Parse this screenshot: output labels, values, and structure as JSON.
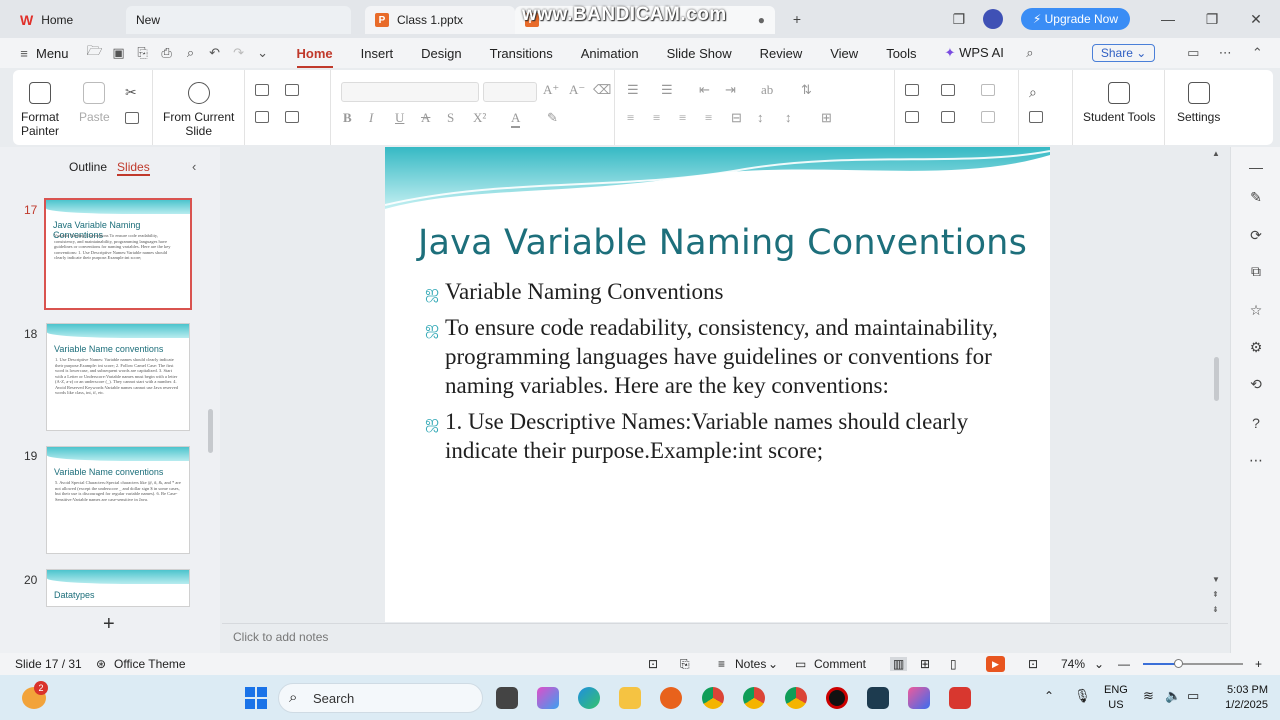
{
  "tabs": {
    "home": "Home",
    "new": "New",
    "document": "Class 1.pptx"
  },
  "watermark": "www.BANDICAM.com",
  "titlebar": {
    "upgrade": "Upgrade Now"
  },
  "menu": {
    "menu": "Menu",
    "items": [
      "Home",
      "Insert",
      "Design",
      "Transitions",
      "Animation",
      "Slide Show",
      "Review",
      "View",
      "Tools"
    ],
    "wps_ai": "WPS AI",
    "share": "Share"
  },
  "ribbon": {
    "format_painter_1": "Format",
    "format_painter_2": "Painter",
    "paste": "Paste",
    "from_current_1": "From Current",
    "from_current_2": "Slide",
    "student_tools": "Student Tools",
    "settings": "Settings"
  },
  "left_panel": {
    "outline": "Outline",
    "slides": "Slides",
    "thumbnails": [
      {
        "num": "17",
        "title": "Java Variable Naming Conventions",
        "text": "Variable Naming Conventions\nTo ensure code readability, consistency, and maintainability, programming languages have guidelines or conventions for naming variables. Here are the key conventions:\n1. Use Descriptive Names:Variable names should clearly indicate their purpose.Example:int score;"
      },
      {
        "num": "18",
        "title": "Variable Name conventions",
        "text": "1. Use Descriptive Names: Variable names should clearly indicate their purpose.Example: int score;\n2. Follow Camel Case: The first word is lowercase, and subsequent words are capitalized.\n3. Start with a Letter or Underscore:Variable names must begin with a letter (A-Z, a-z) or an underscore (_). They cannot start with a number.\n4. Avoid Reserved Keywords:Variable names cannot use Java reserved words like class, int, if, etc."
      },
      {
        "num": "19",
        "title": "Variable Name conventions",
        "text": "5. Avoid Special Characters:Special characters like @, #, &, and * are not allowed (except the underscore _ and dollar sign $ in some cases, but their use is discouraged for regular variable names).\n6. Be Case-Sensitive:Variable names are case-sensitive in Java."
      },
      {
        "num": "20",
        "title": "Datatypes",
        "text": ""
      }
    ]
  },
  "slide": {
    "title": "Java Variable Naming Conventions",
    "bullets": [
      "Variable Naming Conventions",
      "To ensure code readability, consistency, and maintainability, programming languages have guidelines or conventions for naming variables. Here are the key conventions:",
      "1. Use Descriptive Names:Variable names should clearly indicate their purpose.Example:int score;"
    ],
    "bullet_marker": "ஜ"
  },
  "notes_placeholder": "Click to add notes",
  "status": {
    "slide_counter": "Slide 17 / 31",
    "theme": "Office Theme",
    "notes": "Notes",
    "comment": "Comment",
    "zoom": "74%",
    "zoom_fraction": 0.35
  },
  "taskbar": {
    "search": "Search",
    "weather_badge": "2",
    "lang_1": "ENG",
    "lang_2": "US",
    "time": "5:03 PM",
    "date": "1/2/2025"
  },
  "colors": {
    "accent_red": "#c0392b",
    "title_teal": "#1d6f7b",
    "upgrade_blue": "#3a8df5"
  }
}
